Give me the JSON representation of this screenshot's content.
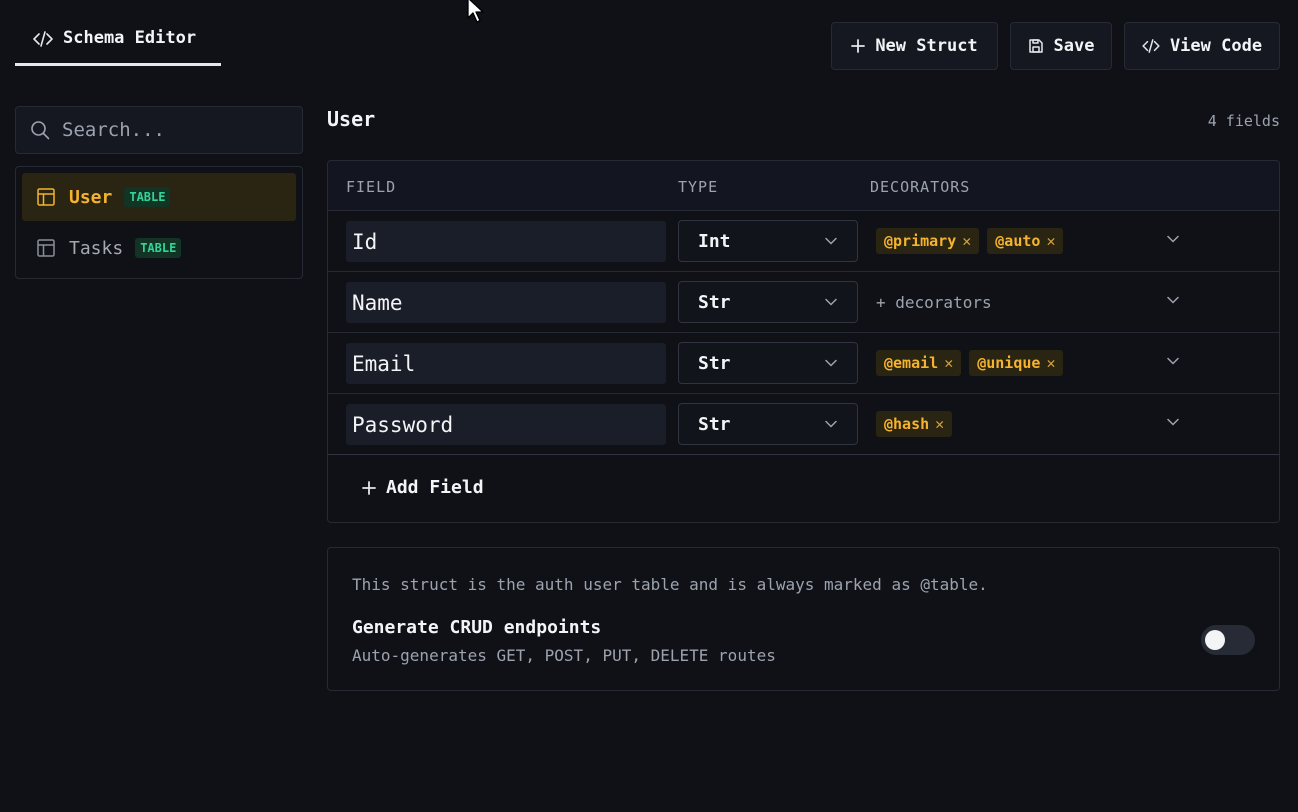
{
  "header": {
    "tab_label": "Schema Editor",
    "tab_icon": "code-icon",
    "buttons": {
      "new_struct": "New Struct",
      "save": "Save",
      "view_code": "View Code"
    }
  },
  "sidebar": {
    "search_placeholder": "Search...",
    "structs": [
      {
        "name": "User",
        "badge": "TABLE",
        "active": true
      },
      {
        "name": "Tasks",
        "badge": "TABLE",
        "active": false
      }
    ]
  },
  "main": {
    "struct_title": "User",
    "field_count": "4 fields",
    "columns": {
      "field": "FIELD",
      "type": "TYPE",
      "decorators": "DECORATORS"
    },
    "fields": [
      {
        "name": "Id",
        "type": "Int",
        "decorators": [
          "@primary",
          "@auto"
        ]
      },
      {
        "name": "Name",
        "type": "Str",
        "decorators": [],
        "placeholder": "+ decorators"
      },
      {
        "name": "Email",
        "type": "Str",
        "decorators": [
          "@email",
          "@unique"
        ]
      },
      {
        "name": "Password",
        "type": "Str",
        "decorators": [
          "@hash"
        ]
      }
    ],
    "add_field_label": "Add Field",
    "info": {
      "description": "This struct is the auth user table and is always marked as @table.",
      "crud_title": "Generate CRUD endpoints",
      "crud_subtitle": "Auto-generates GET, POST, PUT, DELETE routes",
      "crud_enabled": false
    }
  },
  "colors": {
    "background": "#0f1117",
    "accent": "#f5b32e",
    "badge_green": "#34d399"
  }
}
